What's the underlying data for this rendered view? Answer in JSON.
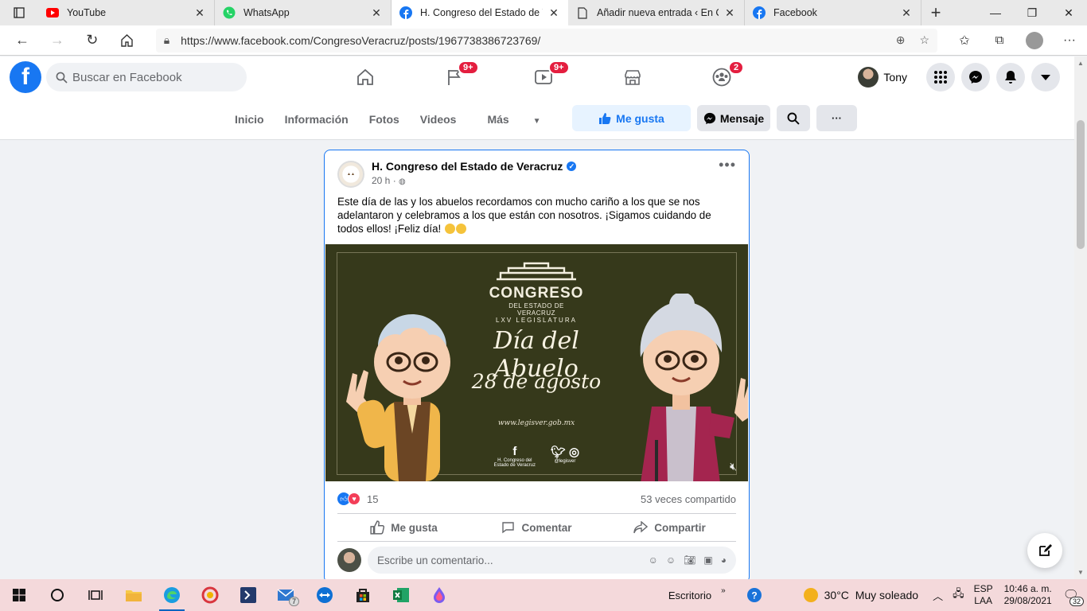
{
  "browser": {
    "tabs": [
      {
        "title": "YouTube",
        "icon": "youtube-icon"
      },
      {
        "title": "WhatsApp",
        "icon": "whatsapp-icon"
      },
      {
        "title": "H. Congreso del Estado de Ve",
        "icon": "facebook-icon",
        "active": true
      },
      {
        "title": "Añadir nueva entrada ‹ En Co",
        "icon": "document-icon"
      },
      {
        "title": "Facebook",
        "icon": "facebook-icon"
      }
    ],
    "url": "https://www.facebook.com/CongresoVeracruz/posts/1967738386723769/"
  },
  "facebook": {
    "search_placeholder": "Buscar en Facebook",
    "notifications": {
      "pages": "9+",
      "watch": "9+",
      "groups": "2"
    },
    "user_name": "Tony"
  },
  "page_tabs": {
    "links": [
      "Inicio",
      "Información",
      "Fotos",
      "Videos",
      "Más"
    ],
    "like_label": "Me gusta",
    "message_label": "Mensaje"
  },
  "post": {
    "author": "H. Congreso del Estado de Veracruz",
    "time": "20 h ·",
    "text": "Este día de las y los abuelos recordamos con mucho cariño a los que se nos adelantaron y celebramos a los que están con nosotros. ¡Sigamos cuidando de todos ellos! ¡Feliz día!",
    "media": {
      "logo_title": "CONGRESO",
      "logo_sub1": "DEL ESTADO DE VERACRUZ",
      "logo_sub2": "LXV LEGISLATURA",
      "headline": "Día del Abuelo",
      "date": "28 de agosto",
      "website": "www.legisver.gob.mx",
      "fb_caption": "H. Congreso del Estado de Veracruz",
      "tw_caption": "@legisver"
    },
    "reaction_count": "15",
    "shares": "53 veces compartido",
    "actions": {
      "like": "Me gusta",
      "comment": "Comentar",
      "share": "Compartir"
    },
    "comment_placeholder": "Escribe un comentario..."
  },
  "taskbar": {
    "desktop_label": "Escritorio",
    "weather": "30°C  Muy soleado",
    "lang_top": "ESP",
    "lang_bottom": "LAA",
    "time": "10:46 a. m.",
    "date": "29/08/2021",
    "notif_count": "32",
    "mail_badge": "7"
  }
}
